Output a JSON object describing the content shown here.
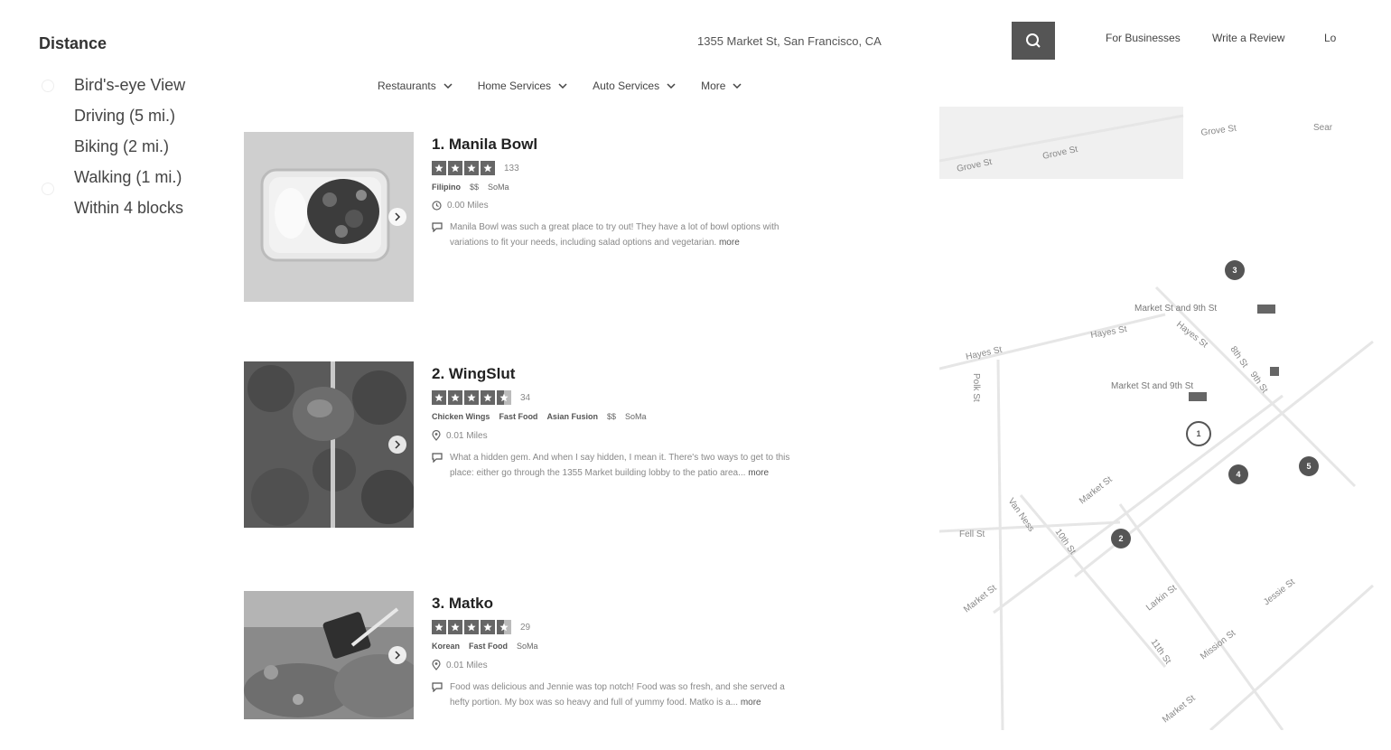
{
  "filter": {
    "title": "Distance",
    "options": [
      "Bird's-eye View",
      "Driving (5 mi.)",
      "Biking (2 mi.)",
      "Walking (1 mi.)",
      "Within 4 blocks"
    ]
  },
  "header": {
    "near": "1355 Market St, San Francisco, CA",
    "links": [
      "For Businesses",
      "Write a Review",
      "Lo"
    ]
  },
  "categories": [
    "Restaurants",
    "Home Services",
    "Auto Services",
    "More"
  ],
  "results": [
    {
      "name": "1. Manila Bowl",
      "review_count": "133",
      "tags": [
        "Filipino"
      ],
      "price": "$$",
      "neighborhood": "SoMa",
      "distance": "0.00 Miles",
      "snippet": "Manila Bowl was such a great place to try out! They have a lot of bowl options with",
      "snippet2": "variations to fit your needs, including salad options and vegetarian.",
      "more": "more",
      "stars": 4
    },
    {
      "name": "2. WingSlut",
      "review_count": "34",
      "tags": [
        "Chicken Wings",
        "Fast Food",
        "Asian Fusion"
      ],
      "price": "$$",
      "neighborhood": "SoMa",
      "distance": "0.01 Miles",
      "snippet": "What a hidden gem. And when I say hidden, I mean it. There's two ways to get to this",
      "snippet2": "place: either go through the 1355 Market building lobby to the patio area...",
      "more": "more",
      "stars": 4.5
    },
    {
      "name": "3. Matko",
      "review_count": "29",
      "tags": [
        "Korean",
        "Fast Food"
      ],
      "price": "",
      "neighborhood": "SoMa",
      "distance": "0.01 Miles",
      "snippet": "Food was delicious and Jennie was top notch! Food was so fresh, and she served a",
      "snippet2": "hefty portion. My box was so heavy and full of yummy food. Matko is a...",
      "more": "more",
      "stars": 4.5
    }
  ],
  "map": {
    "streets": [
      "Grove St",
      "Grove St",
      "Grove St",
      "Hayes St",
      "Hayes St",
      "Hayes St",
      "Polk St",
      "Market St",
      "Fell St",
      "10th St",
      "Market St",
      "Larkin St",
      "11th St",
      "Jessie St",
      "Mission St",
      "9th St",
      "8th St",
      "Van Ness",
      "Market St",
      "Sear"
    ],
    "stops": [
      "Market St and 9th St",
      "Market St and 9th St"
    ],
    "markers": [
      "1",
      "2",
      "3",
      "4",
      "5"
    ]
  },
  "colors": {
    "star": "#666666",
    "search_button": "#555555",
    "marker": "#555555"
  }
}
